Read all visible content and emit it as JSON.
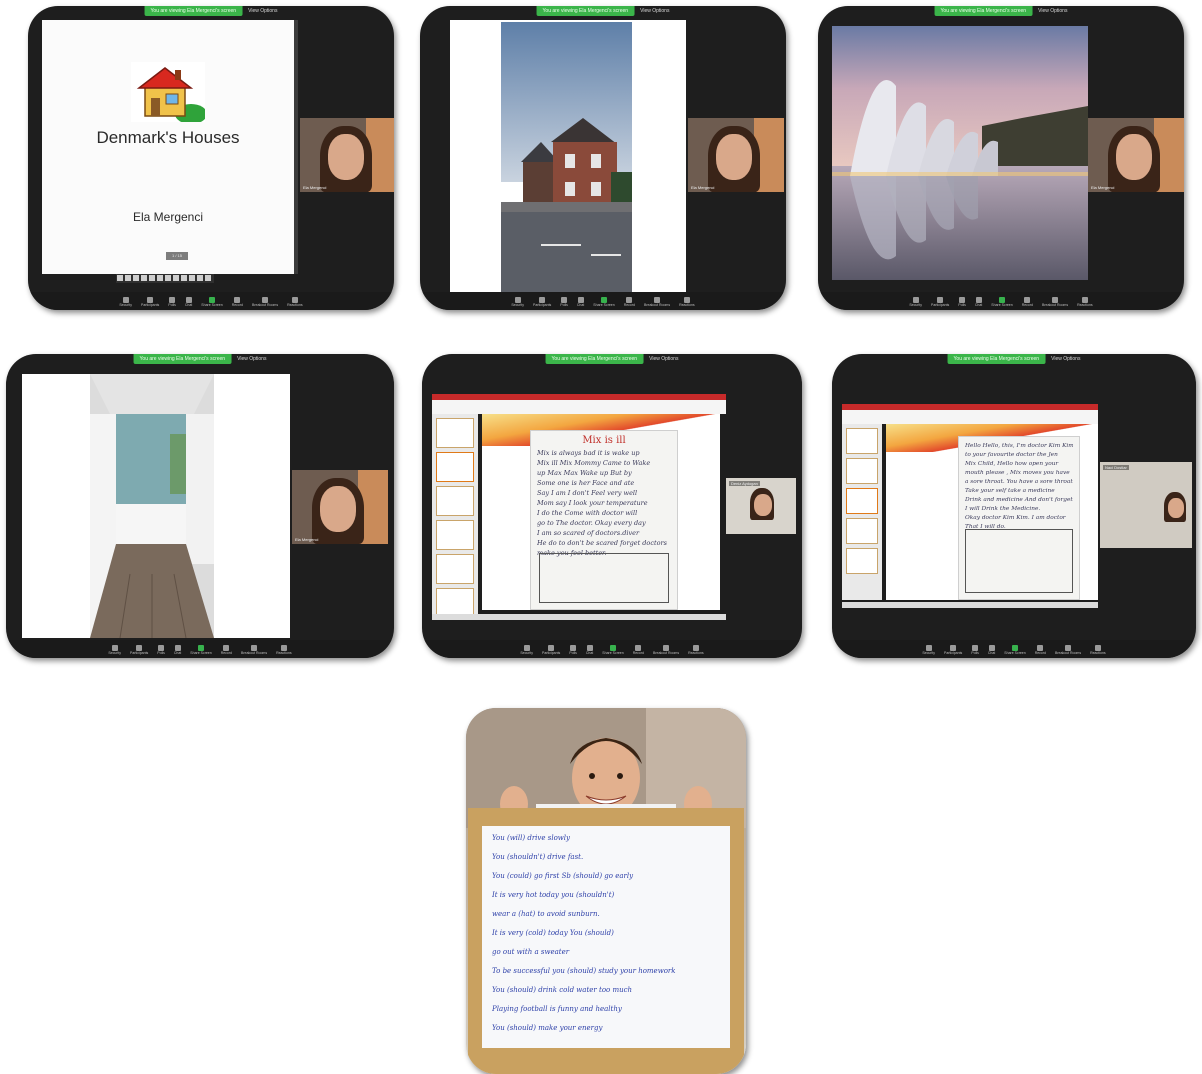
{
  "common": {
    "share_tag": "You are viewing Ela Mergenci's screen",
    "view_options": "View Options",
    "toolbar": [
      "Security",
      "Participants",
      "Polls",
      "Chat",
      "Share Screen",
      "Record",
      "Breakout Rooms",
      "Reactions"
    ]
  },
  "panel1": {
    "slide_title": "Denmark's Houses",
    "slide_author": "Ela Mergenci",
    "slide_button": "1 / 15",
    "participant_name": "Ela Mergenci"
  },
  "panel2": {
    "participant_name": "Ela Mergenci"
  },
  "panel3": {
    "participant_name": "Ela Mergenci"
  },
  "panel4": {
    "participant_name": "Ela Mergenci"
  },
  "panel5": {
    "paper_title": "Mix is ill",
    "paper_lines": [
      "Mix is always bad it is wake up",
      "Mix ill Mix Mommy Came to Wake",
      "up Max Max Wake up But by",
      "Some one is her Face and ate",
      "Say I am I don't Feel very well",
      "Mom say I look your temperature",
      "I do the Come with doctor will",
      "go to The doctor. Okay every day",
      "I am so scared of doctors.diver",
      "He do to don't be scared forget doctors",
      "make you feel better."
    ],
    "participant_name": "Deniz Aydogan"
  },
  "panel6": {
    "paper_lines": [
      "Hello Hello, this, I'm doctor Kim Kim",
      "to your favourite doctor the Jen",
      "Mix Child, Hello how open your",
      "mouth please , Mix moves you have",
      "a sore throat. You have a sore throat",
      "Take your self take a medicine",
      "Drink and medicine And don't forget",
      "I will Drink the Medicine.",
      "Okay doctor Kim Kim. I am doctor",
      "That I will do."
    ],
    "participant_name": "Naci Dostlar"
  },
  "panel7": {
    "board_lines": [
      "You (will) drive slowly",
      "You (shouldn't) drive fast.",
      "You (could) go first   Sb (should) go early",
      "It is very hot today you (shouldn't)",
      "wear a (hat) to avoid sunburn.",
      "It is very (cold) today You (should)",
      "go out with a sweater",
      "To be successful you (should) study your homework",
      "You (should) drink cold water too much",
      "Playing football is funny and healthy",
      "You (should) make your energy"
    ]
  }
}
